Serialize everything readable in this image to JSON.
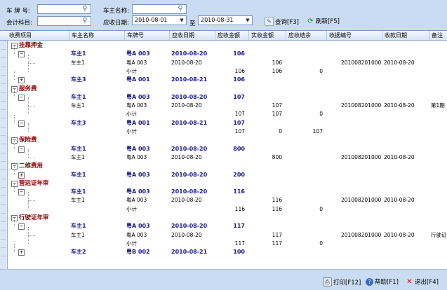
{
  "filters": {
    "plate_label": "车 牌 号:",
    "owner_label": "车主名称:",
    "subject_label": "会计科目:",
    "date_label": "应收日期:",
    "to_label": "至",
    "plate_value": "",
    "owner_value": "",
    "subject_value": "",
    "date_from": "2010-08-01",
    "date_to": "2010-08-31",
    "query_button": "查询[F3]",
    "refresh_button": "刷新[F5]"
  },
  "columns": [
    "收费项目",
    "车主名称",
    "车牌号",
    "应收日期",
    "应收金额",
    "实收金额",
    "应收结余",
    "收据编号",
    "收款日期",
    "备注"
  ],
  "rows": [
    {
      "kind": "cat",
      "label": "挂靠押金"
    },
    {
      "kind": "grp",
      "owner": "车主1",
      "plate": "粤A 003",
      "date": "2010-08-20",
      "due": "106"
    },
    {
      "kind": "det",
      "owner": "车主1",
      "plate": "粤A 003",
      "date": "2010-08-20",
      "paid": "106",
      "receipt": "201008201000",
      "recv_date": "2010-08-20"
    },
    {
      "kind": "sub",
      "plate": "小计",
      "due": "106",
      "paid": "106",
      "bal": "0"
    },
    {
      "kind": "grp",
      "owner": "车主3",
      "plate": "粤A 001",
      "date": "2010-08-21",
      "due": "106",
      "expand": "+"
    },
    {
      "kind": "cat",
      "label": "服务费"
    },
    {
      "kind": "grp",
      "owner": "车主1",
      "plate": "粤A 003",
      "date": "2010-08-20",
      "due": "107"
    },
    {
      "kind": "det",
      "owner": "车主1",
      "plate": "粤A 003",
      "date": "2010-08-20",
      "paid": "107",
      "receipt": "201008201000",
      "recv_date": "2010-08-20",
      "note": "第1期"
    },
    {
      "kind": "sub",
      "plate": "小计",
      "due": "107",
      "paid": "107",
      "bal": "0"
    },
    {
      "kind": "grp",
      "owner": "车主3",
      "plate": "粤A 001",
      "date": "2010-08-21",
      "due": "107"
    },
    {
      "kind": "sub",
      "plate": "小计",
      "due": "107",
      "paid": "0",
      "bal": "107"
    },
    {
      "kind": "cat",
      "label": "保险费"
    },
    {
      "kind": "grp",
      "owner": "车主1",
      "plate": "粤A 003",
      "date": "2010-08-20",
      "due": "800"
    },
    {
      "kind": "det",
      "owner": "车主1",
      "plate": "粤A 003",
      "date": "2010-08-20",
      "paid": "800",
      "receipt": "201008201000",
      "recv_date": "2010-08-20"
    },
    {
      "kind": "cat",
      "label": "二维费用"
    },
    {
      "kind": "grp",
      "owner": "车主1",
      "plate": "粤A 003",
      "date": "2010-08-20",
      "due": "200",
      "expand": "+"
    },
    {
      "kind": "cat",
      "label": "营运证年审"
    },
    {
      "kind": "grp",
      "owner": "车主1",
      "plate": "粤A 003",
      "date": "2010-08-20",
      "due": "116"
    },
    {
      "kind": "det",
      "owner": "车主1",
      "plate": "粤A 003",
      "date": "2010-08-20",
      "paid": "116",
      "receipt": "201008201000",
      "recv_date": "2010-08-20"
    },
    {
      "kind": "sub",
      "plate": "小计",
      "due": "116",
      "paid": "116",
      "bal": "0"
    },
    {
      "kind": "cat",
      "label": "行驶证年审"
    },
    {
      "kind": "grp",
      "owner": "车主1",
      "plate": "粤A 003",
      "date": "2010-08-20",
      "due": "117"
    },
    {
      "kind": "det",
      "owner": "车主1",
      "plate": "粤A 003",
      "date": "2010-08-20",
      "paid": "117",
      "receipt": "201008201000",
      "recv_date": "2010-08-20",
      "note": "行驶证"
    },
    {
      "kind": "sub",
      "plate": "小计",
      "due": "117",
      "paid": "117",
      "bal": "0"
    },
    {
      "kind": "grp",
      "owner": "车主2",
      "plate": "粤B 002",
      "date": "2010-08-21",
      "due": "100",
      "expand": "+"
    }
  ],
  "footer": {
    "print_button": "打印[F12]",
    "help_button": "帮助[F1]",
    "exit_button": "退出[F4]"
  },
  "colors": {
    "category": "#8b0000",
    "group": "#1a1a8c",
    "background": "#c9dcf2"
  }
}
